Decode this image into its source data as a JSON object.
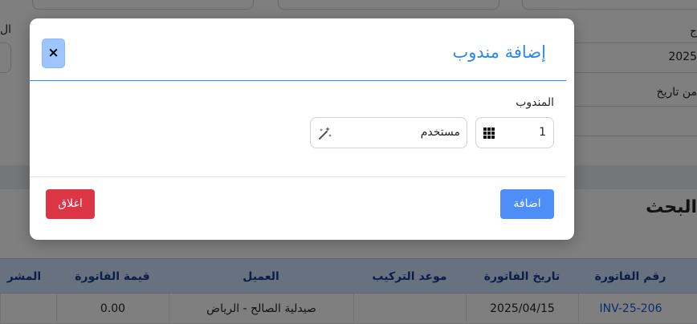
{
  "background": {
    "field_date_label": "من تاريخ",
    "field_year_value": "2025",
    "field_top_right_label": "ج",
    "field_left_label": "ال",
    "search_title": "البحث",
    "table": {
      "headers": [
        "رقم الفاتورة",
        "تاريخ الفاتورة",
        "موعد التركيب",
        "العميل",
        "قيمة الفاتورة",
        "المشر"
      ],
      "rows": [
        {
          "invoice_no": "INV-25-206",
          "invoice_date": "2025/04/15",
          "install_date": "",
          "client": "صيدلية الصالح - الرياض",
          "amount": "0.00",
          "supervisor": ""
        }
      ]
    }
  },
  "modal": {
    "title": "إضافة مندوب",
    "close_symbol": "×",
    "field_label": "المندوب",
    "code_value": "1",
    "user_placeholder": "مستخدم",
    "add_button": "اضافة",
    "close_button": "اغلاق",
    "icons": {
      "code": "grid-icon",
      "user": "magic-wand-icon"
    }
  },
  "colors": {
    "primary": "#4d8ff7",
    "title": "#2b8be6",
    "danger": "#dc3545",
    "close_bg": "#9ec5fe",
    "table_header": "#cfe2ff"
  }
}
